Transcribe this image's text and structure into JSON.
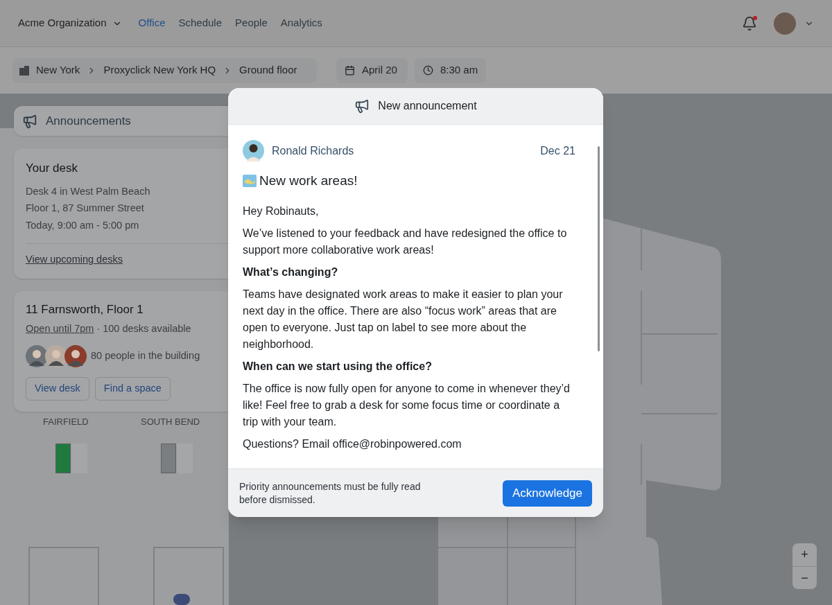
{
  "top_nav": {
    "organization": "Acme Organization",
    "tabs": [
      {
        "label": "Office",
        "selected": true
      },
      {
        "label": "Schedule",
        "selected": false
      },
      {
        "label": "People",
        "selected": false
      },
      {
        "label": "Analytics",
        "selected": false
      }
    ],
    "notifications_unread": true
  },
  "location_bar": {
    "breadcrumb": [
      "New York",
      "Proxyclick New York HQ",
      "Ground floor"
    ],
    "date": "April 20",
    "time": "8:30 am"
  },
  "announcements_button": "Announcements",
  "desk_card": {
    "title": "Your desk",
    "lines": [
      "Desk 4 in West Palm Beach",
      "Floor 1, 87 Summer Street",
      "Today, 9:00 am - 5:00 pm"
    ],
    "link": "View upcoming desks"
  },
  "building_card": {
    "title": "11 Farnsworth, Floor 1",
    "hours_link": "Open until 7pm",
    "availability": "· 100 desks available",
    "people": "80 people in the building",
    "avatars": [
      {
        "kind": "picture"
      },
      {
        "kind": "picture"
      },
      {
        "kind": "picture"
      }
    ],
    "buttons": [
      "View desk",
      "Find a space"
    ]
  },
  "map": {
    "labels": [
      "FAIRFIELD",
      "SOUTH BEND"
    ],
    "desks": [
      {
        "color": "#1f7a3d"
      },
      {
        "color": "#7b7e81"
      }
    ],
    "zoom_buttons": [
      "+",
      "−"
    ]
  },
  "modal": {
    "title": "New announcement",
    "author": "Ronald Richards",
    "date": "Dec 21",
    "headline": "New work areas!",
    "body": [
      {
        "kind": "paragraph",
        "text": "Hey Robinauts,"
      },
      {
        "kind": "paragraph",
        "text": "We’ve listened to your feedback and have redesigned the office to support more collaborative work areas!"
      },
      {
        "kind": "heading",
        "text": "What’s changing?"
      },
      {
        "kind": "paragraph",
        "text": "Teams have designated work areas to make it easier to plan your next day in the office. There are also “focus work” areas that are open to everyone. Just tap on label to see more about the neighborhood."
      },
      {
        "kind": "heading",
        "text": "When can we start using the office?"
      },
      {
        "kind": "paragraph",
        "text": "The office is now fully open for anyone to come in whenever they’d like! Feel free to grab a desk for some focus time or coordinate a trip with your team."
      },
      {
        "kind": "paragraph",
        "text": "Questions? Email office@robinpowered.com"
      }
    ],
    "footer_note": "Priority announcements must be fully read before dismissed.",
    "button": "Acknowledge"
  }
}
